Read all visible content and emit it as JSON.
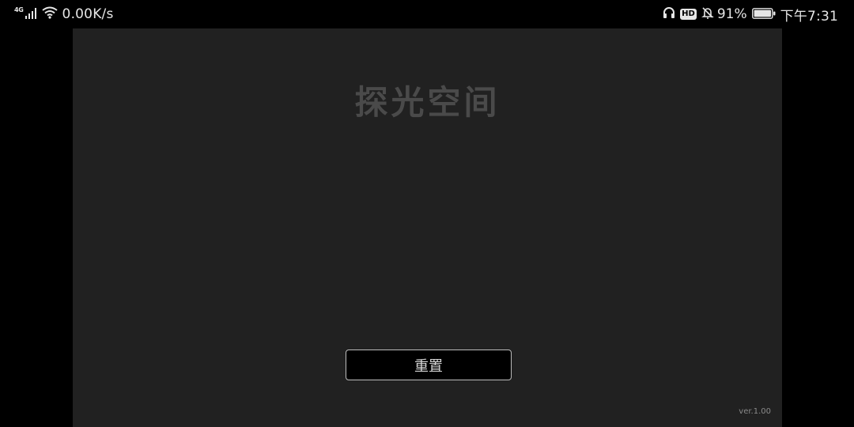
{
  "status_bar": {
    "network_type": "4G",
    "net_speed": "0.00K/s",
    "battery_percent": "91%",
    "time": "下午7:31",
    "hd_badge": "HD",
    "icons": [
      "signal-icon",
      "wifi-icon",
      "headphones-icon",
      "hd-icon",
      "bell-muted-icon",
      "battery-icon"
    ]
  },
  "app": {
    "title": "探光空间",
    "reset_button_label": "重置",
    "version": "ver.1.00"
  },
  "colors": {
    "screen_bg": "#000000",
    "panel_bg": "#212121",
    "title_color": "#4a4a4a",
    "button_border": "#bdbdbd"
  }
}
